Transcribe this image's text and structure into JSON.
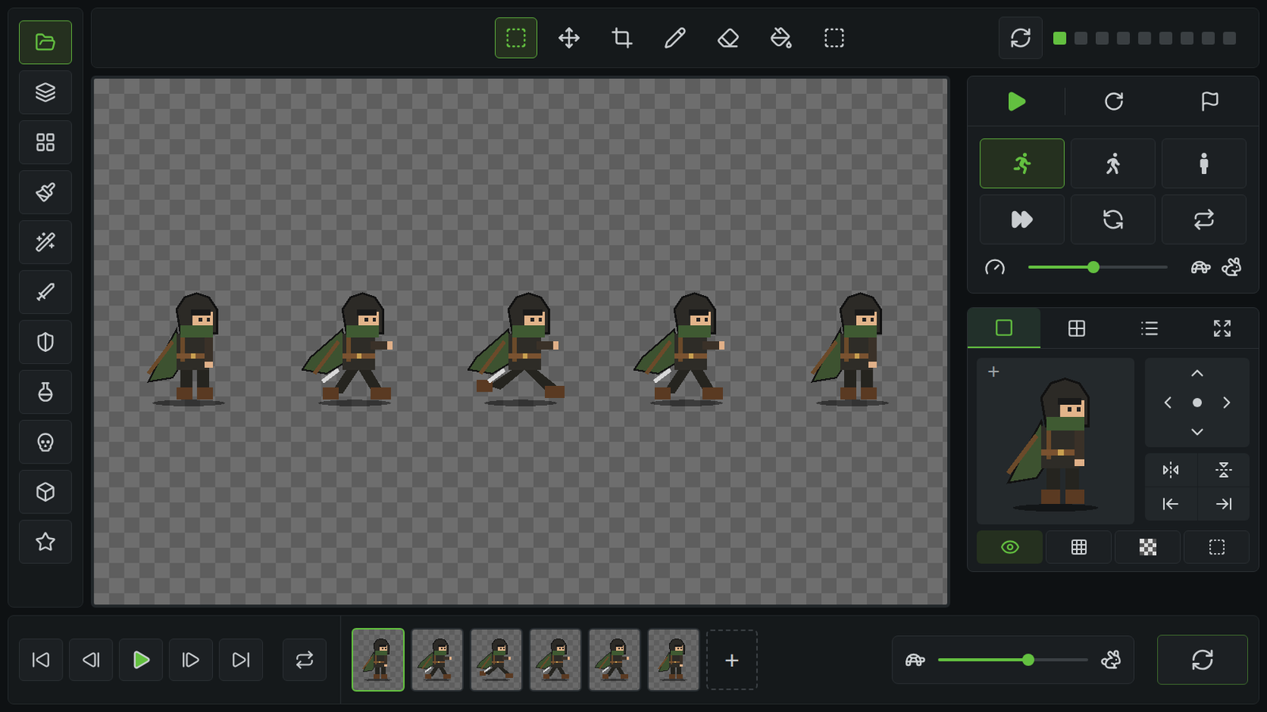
{
  "sidebar": {
    "items": [
      {
        "selected": true
      },
      {
        "selected": false
      },
      {
        "selected": false
      },
      {
        "selected": false
      },
      {
        "selected": false
      },
      {
        "selected": false
      },
      {
        "selected": false
      },
      {
        "selected": false
      },
      {
        "selected": false
      },
      {
        "selected": false
      },
      {
        "selected": false
      }
    ]
  },
  "toolbar": {
    "tools": [
      {
        "selected": true
      },
      {
        "selected": false
      },
      {
        "selected": false
      },
      {
        "selected": false
      },
      {
        "selected": false
      },
      {
        "selected": false
      },
      {
        "selected": false
      }
    ]
  },
  "page_dots": [
    {
      "selected": true
    },
    {
      "selected": false
    },
    {
      "selected": false
    },
    {
      "selected": false
    },
    {
      "selected": false
    },
    {
      "selected": false
    },
    {
      "selected": false
    },
    {
      "selected": false
    },
    {
      "selected": false
    }
  ],
  "canvas": {
    "sprites": [
      {
        "kind": "stand"
      },
      {
        "kind": "stride"
      },
      {
        "kind": "run"
      },
      {
        "kind": "stride"
      },
      {
        "kind": "stand"
      }
    ]
  },
  "animation": {
    "modes": [
      {
        "selected": true
      },
      {
        "selected": false
      },
      {
        "selected": false
      }
    ],
    "speed": {
      "level": 0.47
    }
  },
  "preview": {
    "tabs": [
      {
        "selected": true
      },
      {
        "selected": false
      },
      {
        "selected": false
      },
      {
        "selected": false
      }
    ],
    "add_label": "+",
    "sprite": {
      "kind": "stand"
    },
    "view_toggles": [
      {
        "selected": true
      },
      {
        "selected": false
      },
      {
        "selected": false
      },
      {
        "selected": false
      }
    ]
  },
  "timeline": {
    "frames": [
      {
        "kind": "stand",
        "selected": true
      },
      {
        "kind": "stride",
        "selected": false
      },
      {
        "kind": "run",
        "selected": false
      },
      {
        "kind": "stride",
        "selected": false
      },
      {
        "kind": "stride",
        "selected": false
      },
      {
        "kind": "stand",
        "selected": false
      }
    ],
    "add_label": "+",
    "speed": {
      "level": 0.6
    }
  }
}
